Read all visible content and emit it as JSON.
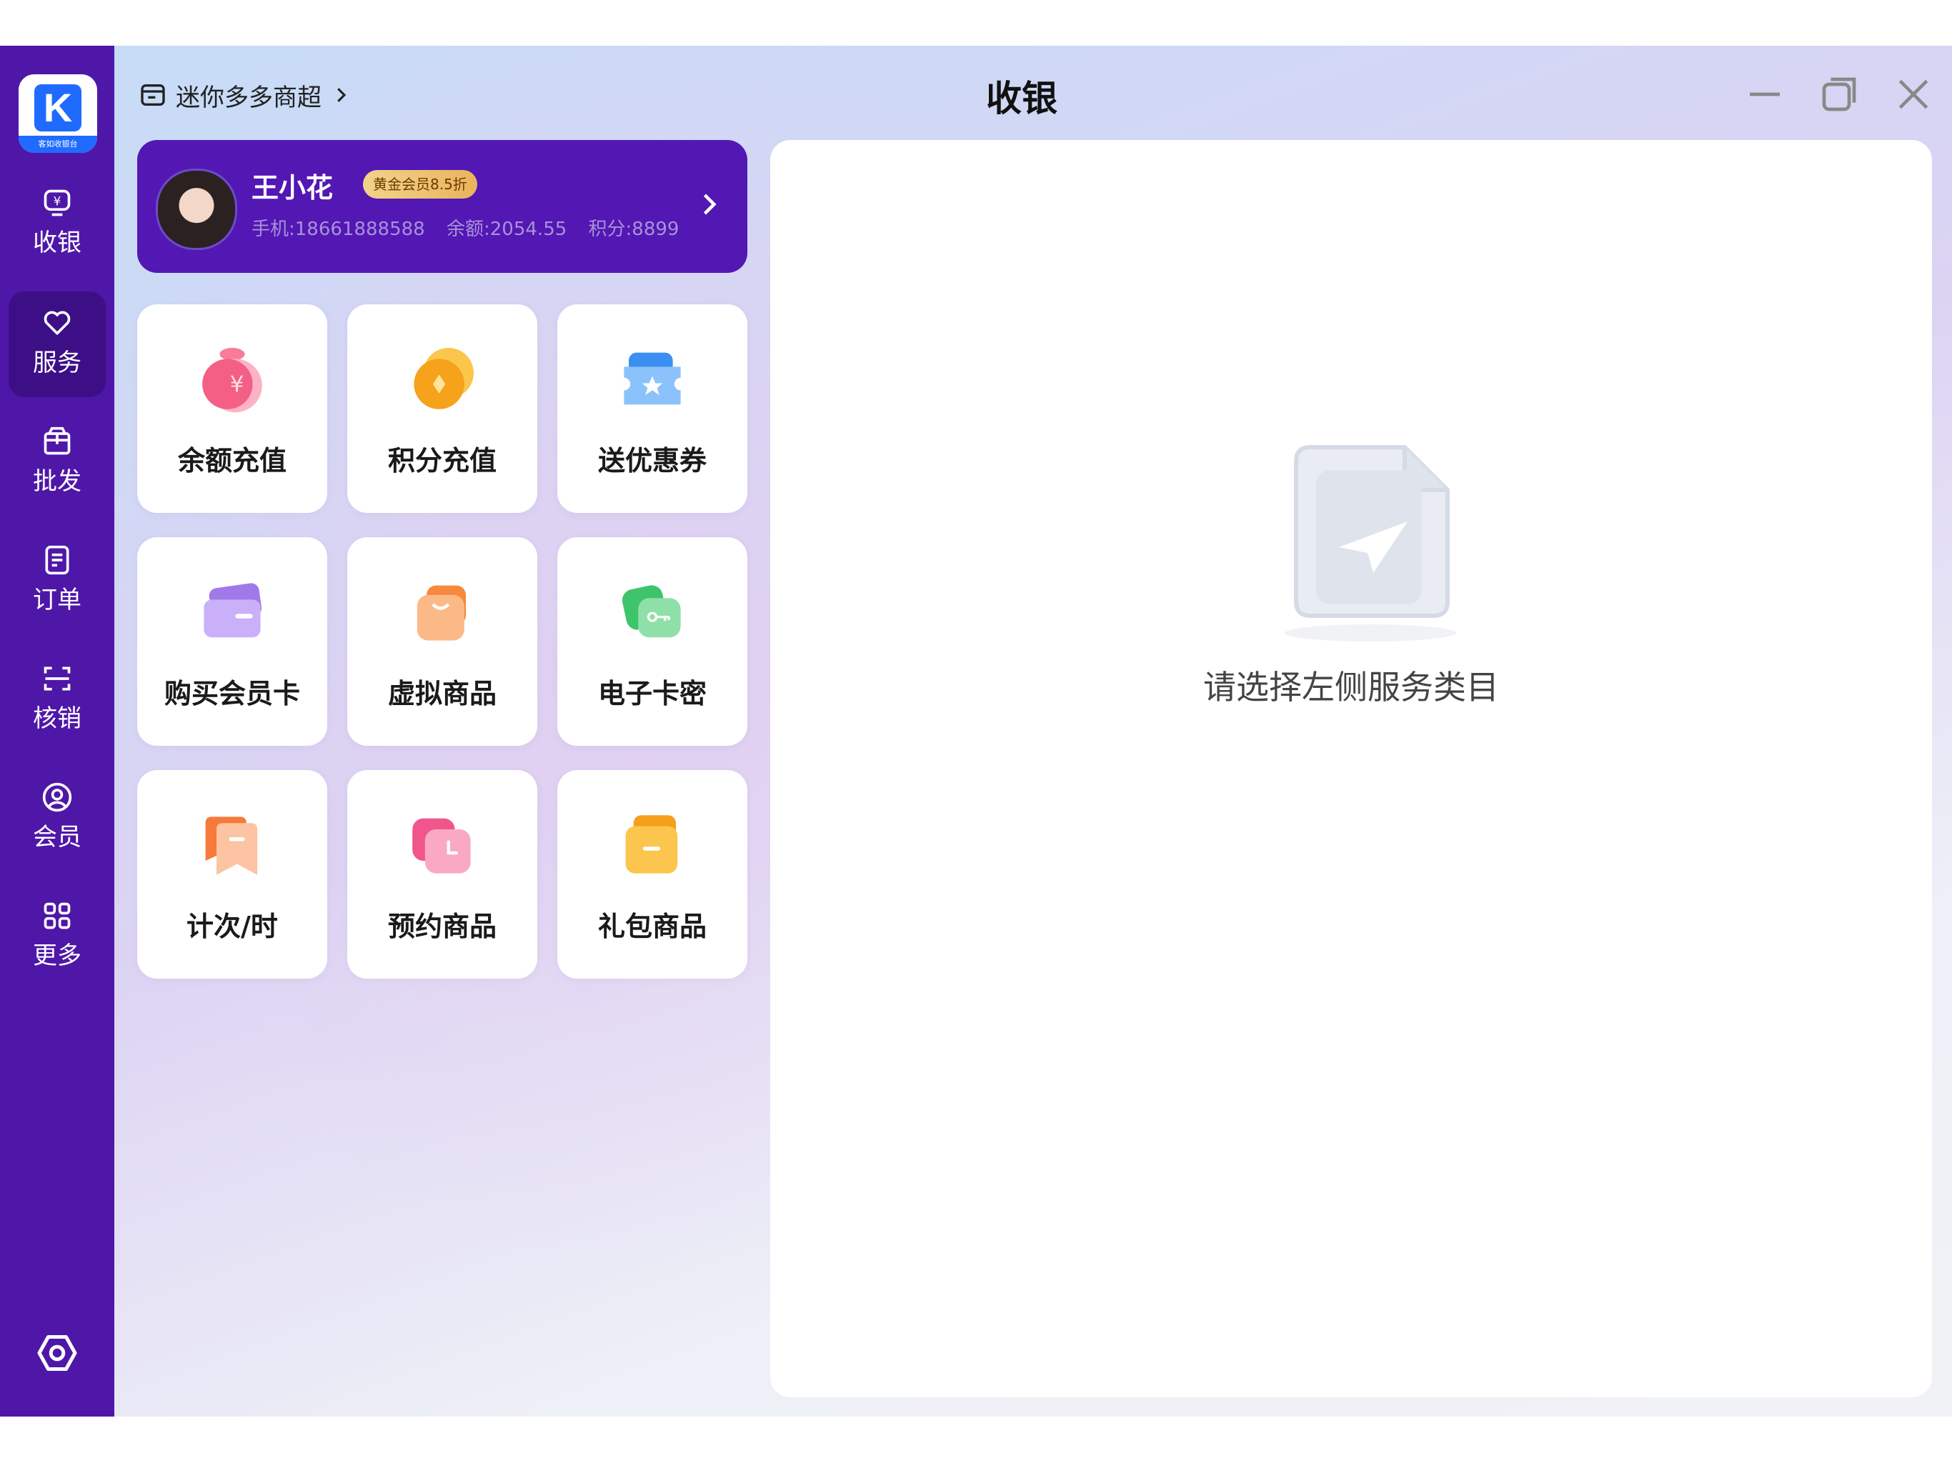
{
  "app": {
    "logo_text": "K",
    "logo_caption": "客如收银台",
    "title": "收银",
    "store_name": "迷你多多商超"
  },
  "nav": [
    {
      "label": "收银",
      "icon": "cashier-icon"
    },
    {
      "label": "服务",
      "icon": "heart-icon",
      "active": true
    },
    {
      "label": "批发",
      "icon": "box-icon"
    },
    {
      "label": "订单",
      "icon": "order-icon"
    },
    {
      "label": "核销",
      "icon": "scan-icon"
    },
    {
      "label": "会员",
      "icon": "member-icon"
    },
    {
      "label": "更多",
      "icon": "grid-icon"
    }
  ],
  "member": {
    "name": "王小花",
    "badge": "黄金会员8.5折",
    "phone": "手机:18661888588",
    "balance": "余额:2054.55",
    "points": "积分:8899"
  },
  "services": [
    {
      "label": "余额充值",
      "icon": "money-bag-icon",
      "color": "#f45f85"
    },
    {
      "label": "积分充值",
      "icon": "coin-icon",
      "color": "#f6a21b"
    },
    {
      "label": "送优惠券",
      "icon": "coupon-icon",
      "color": "#3b8ff0"
    },
    {
      "label": "购买会员卡",
      "icon": "card-icon",
      "color": "#a07ae8"
    },
    {
      "label": "虚拟商品",
      "icon": "bag-icon",
      "color": "#f6893c"
    },
    {
      "label": "电子卡密",
      "icon": "key-card-icon",
      "color": "#3ec46b"
    },
    {
      "label": "计次/时",
      "icon": "ticket-icon",
      "color": "#f77a3b"
    },
    {
      "label": "预约商品",
      "icon": "clock-icon",
      "color": "#f0568b"
    },
    {
      "label": "礼包商品",
      "icon": "gift-box-icon",
      "color": "#f5a01c"
    }
  ],
  "empty_state": {
    "text": "请选择左侧服务类目",
    "icon": "document-send-icon"
  },
  "colors": {
    "sidebar": "#4f17a8",
    "member_card": "#5317b4"
  }
}
